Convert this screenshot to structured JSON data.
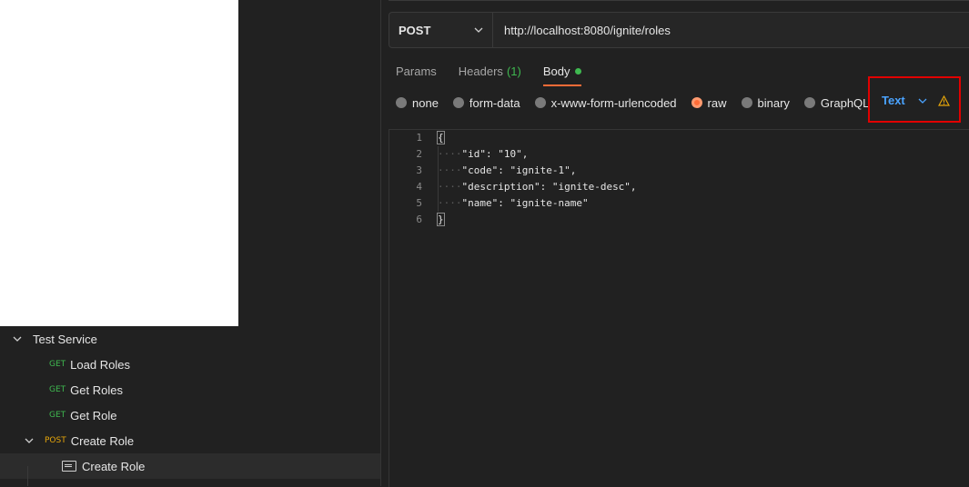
{
  "sidebar": {
    "tree": [
      {
        "label": "Test Service",
        "method": "",
        "kind": "folder"
      },
      {
        "label": "Load Roles",
        "method": "GET",
        "kind": "request"
      },
      {
        "label": "Get Roles",
        "method": "GET",
        "kind": "request"
      },
      {
        "label": "Get Role",
        "method": "GET",
        "kind": "request"
      },
      {
        "label": "Create Role",
        "method": "POST",
        "kind": "request"
      },
      {
        "label": "Create Role",
        "method": "",
        "kind": "example"
      }
    ]
  },
  "request": {
    "method": "POST",
    "url": "http://localhost:8080/ignite/roles"
  },
  "tabs": [
    {
      "label": "Params"
    },
    {
      "label": "Headers",
      "count": "(1)"
    },
    {
      "label": "Body"
    }
  ],
  "body_options": [
    "none",
    "form-data",
    "x-www-form-urlencoded",
    "raw",
    "binary",
    "GraphQL"
  ],
  "body_type": {
    "selected": "Text"
  },
  "editor": {
    "line_numbers": [
      "1",
      "2",
      "3",
      "4",
      "5",
      "6"
    ],
    "lines": [
      {
        "indent": "",
        "text": "{"
      },
      {
        "indent": "····",
        "text": "\"id\": \"10\","
      },
      {
        "indent": "····",
        "text": "\"code\": \"ignite-1\","
      },
      {
        "indent": "····",
        "text": "\"description\": \"ignite-desc\","
      },
      {
        "indent": "····",
        "text": "\"name\": \"ignite-name\""
      },
      {
        "indent": "",
        "text": "}"
      }
    ]
  },
  "colors": {
    "accent": "#ff6c37",
    "get": "#3fb950",
    "post": "#e5a50a",
    "link": "#4aa3ff",
    "highlight": "#e10000",
    "warning": "#e5a50a"
  }
}
